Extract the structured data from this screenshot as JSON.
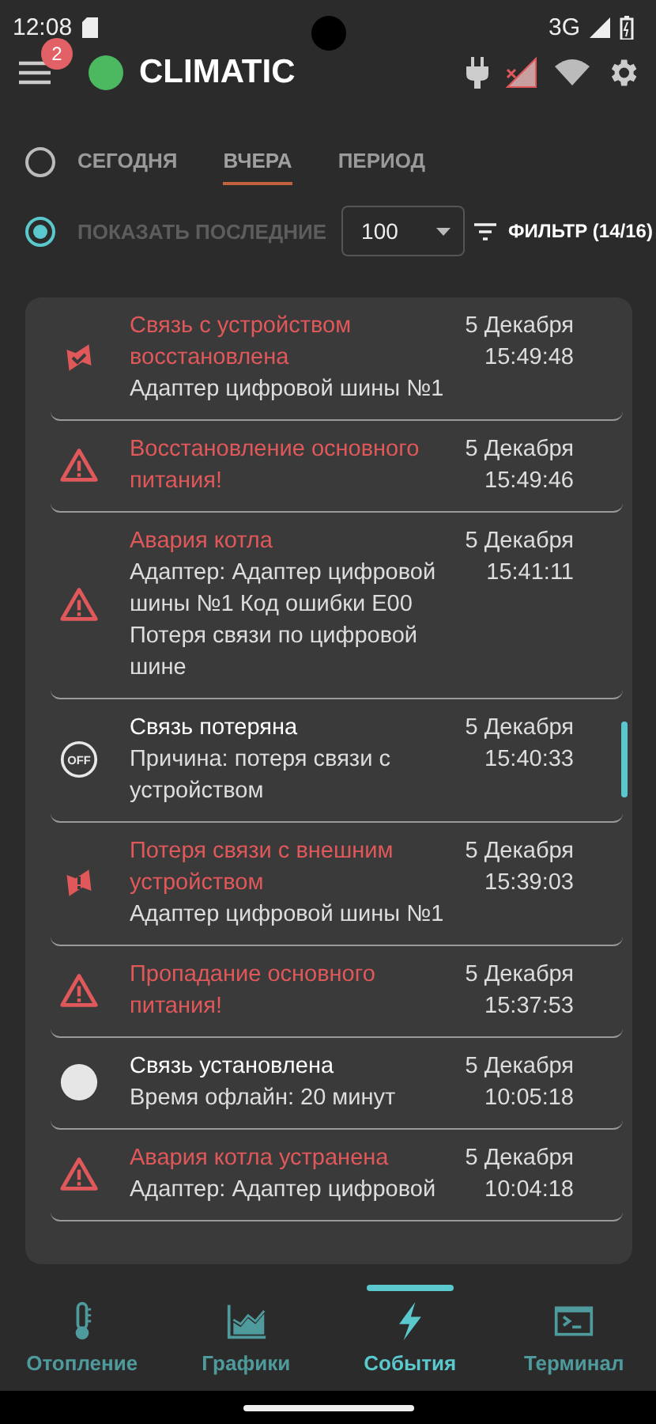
{
  "status_bar": {
    "time": "12:08",
    "network": "3G"
  },
  "app_bar": {
    "menu_badge": "2",
    "title": "CLIMATIC",
    "connected": true
  },
  "period": {
    "radio_selected": false,
    "tabs": [
      {
        "label": "СЕГОДНЯ",
        "selected": false
      },
      {
        "label": "ВЧЕРА",
        "selected": true
      },
      {
        "label": "ПЕРИОД",
        "selected": false
      }
    ]
  },
  "last": {
    "radio_selected": true,
    "label": "ПОКАЗАТЬ ПОСЛЕДНИЕ",
    "count": "100",
    "filter": "ФИЛЬТР (14/16)"
  },
  "events": [
    {
      "kind": "link-restored",
      "alarm": true,
      "title": "Связь с устройством восстановлена",
      "detail": "Адаптер цифровой шины №1",
      "date": "5 Декабря",
      "time": "15:49:48"
    },
    {
      "kind": "warning",
      "alarm": true,
      "title": "Восстановление основного питания!",
      "date": "5 Декабря",
      "time": "15:49:46"
    },
    {
      "kind": "warning",
      "alarm": true,
      "title": "Авария котла",
      "detail": "Адаптер: Адаптер цифровой шины №1 Код ошибки E00 Потеря связи по цифровой шине",
      "date": "5 Декабря",
      "time": "15:41:11"
    },
    {
      "kind": "off",
      "icon_text": "OFF",
      "alarm": false,
      "title": "Связь потеряна",
      "detail": "Причина: потеря связи с устройством",
      "date": "5 Декабря",
      "time": "15:40:33"
    },
    {
      "kind": "link-lost",
      "alarm": true,
      "title": "Потеря связи с внешним устройством",
      "detail": "Адаптер цифровой шины №1",
      "date": "5 Декабря",
      "time": "15:39:03"
    },
    {
      "kind": "warning",
      "alarm": true,
      "title": "Пропадание основного питания!",
      "date": "5 Декабря",
      "time": "15:37:53"
    },
    {
      "kind": "online",
      "alarm": false,
      "title": "Связь установлена",
      "detail": "Время офлайн: 20 минут",
      "date": "5 Декабря",
      "time": "10:05:18"
    },
    {
      "kind": "warning",
      "alarm": true,
      "title": "Авария котла устранена",
      "detail": "Адаптер: Адаптер цифровой",
      "date": "5 Декабря",
      "time": "10:04:18"
    }
  ],
  "nav": [
    {
      "kind": "heating",
      "label": "Отопление",
      "selected": false
    },
    {
      "kind": "charts",
      "label": "Графики",
      "selected": false
    },
    {
      "kind": "events",
      "label": "События",
      "selected": true
    },
    {
      "kind": "terminal",
      "label": "Терминал",
      "selected": false
    }
  ]
}
